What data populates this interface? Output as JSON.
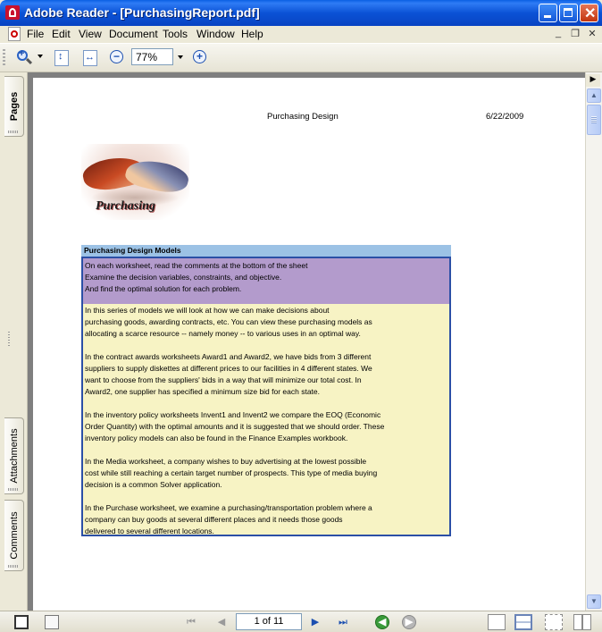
{
  "window": {
    "title": "Adobe Reader - [PurchasingReport.pdf]",
    "minimize_label": "_",
    "close_label": "✕"
  },
  "menu": {
    "items": [
      "File",
      "Edit",
      "View",
      "Document",
      "Tools",
      "Window",
      "Help"
    ],
    "mdi_minimize": "_",
    "mdi_restore": "❐",
    "mdi_close": "✕"
  },
  "toolbar": {
    "zoom_value": "77%",
    "zoom_out_glyph": "−",
    "zoom_in_glyph": "+"
  },
  "side_tabs": {
    "pages": "Pages",
    "attachments": "Attachments",
    "comments": "Comments"
  },
  "document": {
    "header_title": "Purchasing Design",
    "header_date": "6/22/2009",
    "image_caption": "Purchasing",
    "textbox_heading": "Purchasing Design Models",
    "intro_lines": [
      "On each worksheet, read the comments at the bottom of the sheet",
      "Examine the decision variables, constraints, and objective.",
      "And find the optimal solution for each problem."
    ],
    "body_lines": [
      "In this series of models we will look at how we can make decisions about",
      "purchasing goods, awarding contracts, etc.  You can view these purchasing models as",
      "allocating a scarce resource -- namely money -- to various uses in an optimal way.",
      "",
      "In the contract awards worksheets Award1 and Award2, we have bids from 3 different",
      "suppliers to supply diskettes at different prices to our facilities in 4 different states.  We",
      "want to choose from the suppliers' bids in a way that will minimize our total cost.  In",
      "Award2, one supplier has specified a minimum size bid for each state.",
      "",
      "In the inventory policy worksheets Invent1 and Invent2 we compare the EOQ (Economic",
      "Order Quantity) with the optimal amounts and it is suggested that we should order. These",
      "inventory policy models can also be found in the Finance Examples workbook.",
      "",
      "In the Media worksheet, a company wishes to buy advertising at the lowest possible",
      "cost while still reaching a certain target number of prospects.  This type of media buying",
      "decision is a common Solver application.",
      "",
      "In the Purchase worksheet, we examine a purchasing/transportation problem where a",
      "company can buy goods at several different places and it needs those goods",
      "delivered to several different locations."
    ]
  },
  "statusbar": {
    "page_indicator": "1 of 11"
  }
}
